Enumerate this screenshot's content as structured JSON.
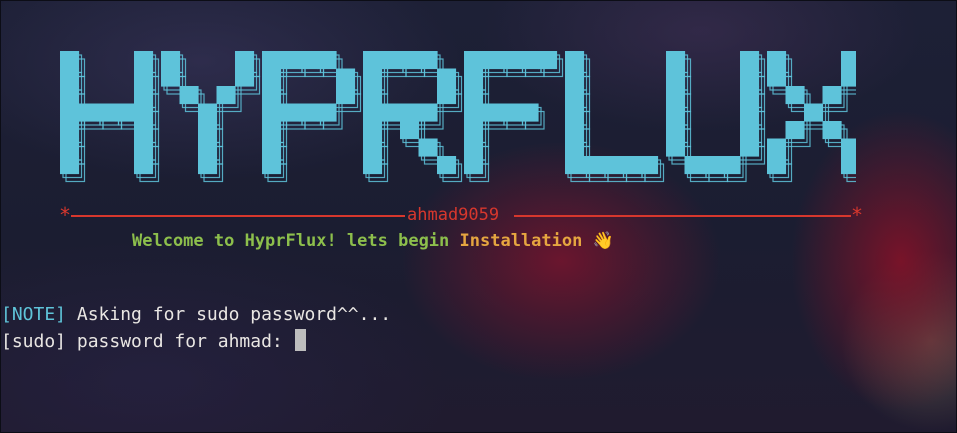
{
  "banner": {
    "title": "HYPRFLUX",
    "fill_color": "#5ec3da",
    "outline_color": "#5ec3da"
  },
  "rule": {
    "author": "ahmad9059",
    "star": "*",
    "color": "#d7372d"
  },
  "welcome": {
    "part1": "Welcome to HyprFlux! lets begin ",
    "part2": "Installation ",
    "emoji": "👋"
  },
  "terminal": {
    "note_tag": "[NOTE]",
    "note_text": " Asking for sudo password^^...",
    "prompt_text": "[sudo] password for ahmad: "
  }
}
